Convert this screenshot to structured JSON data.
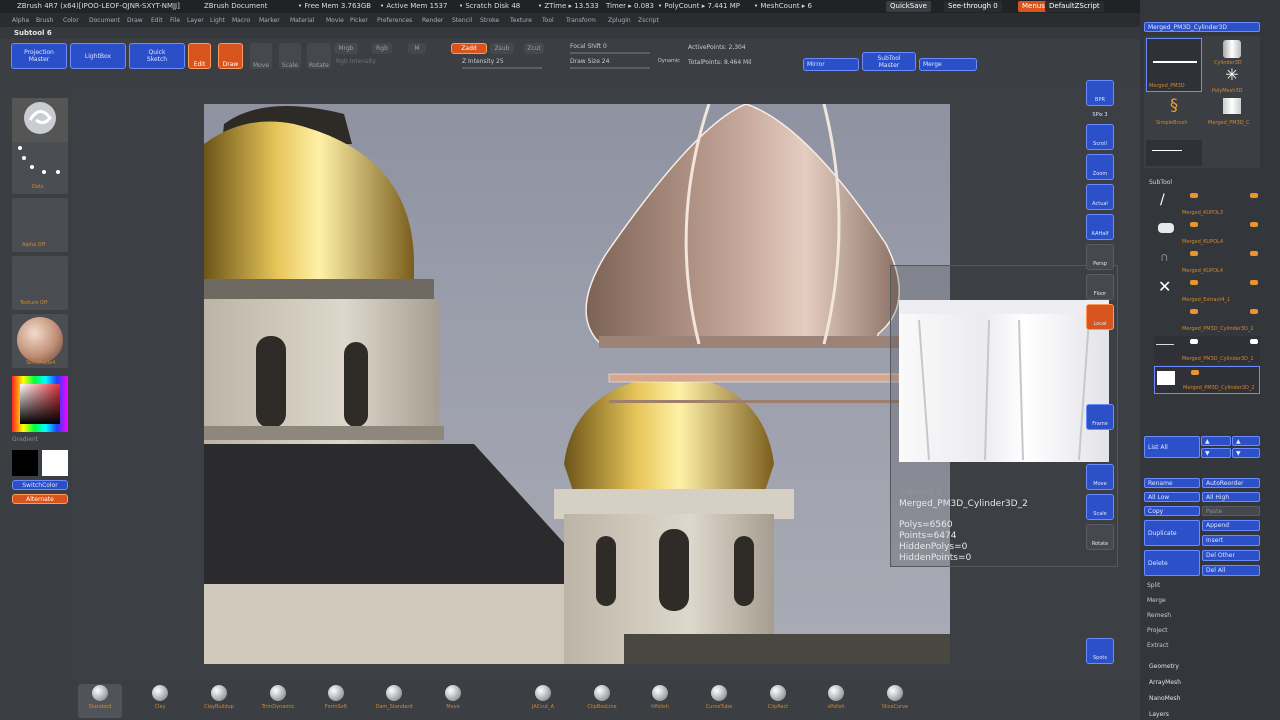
{
  "titlebar": {
    "app": "ZBrush 4R7 (x64)[IPOO-LEOF-QJNR-SXYT-NMJJ]",
    "doc": "ZBrush Document",
    "free_mem": "• Free Mem 3.763GB",
    "active_mem": "• Active Mem 1537",
    "scratch": "• Scratch Disk 48",
    "ztime": "• ZTime ▸ 13.533",
    "timer": "Timer ▸ 0.083",
    "polycount": "• PolyCount ▸ 7.441 MP",
    "meshcount": "• MeshCount ▸ 6",
    "quicksave": "QuickSave",
    "seethrough": "See-through  0",
    "menus": "Menus",
    "script": "DefaultZScript"
  },
  "menus": [
    "Alpha",
    "Brush",
    "Color",
    "Document",
    "Draw",
    "Edit",
    "File",
    "Layer",
    "Light",
    "Macro",
    "Marker",
    "Material",
    "Movie",
    "Picker",
    "Preferences",
    "Render",
    "Stencil",
    "Stroke",
    "Texture",
    "Tool",
    "Transform",
    "Zplugin",
    "Zscript"
  ],
  "subtool_label": "Subtool 6",
  "shelf": {
    "projection": "Projection\nMaster",
    "lightbox": "LightBox",
    "quicksketch": "Quick\nSketch",
    "edit": "Edit",
    "draw": "Draw",
    "move": "Move",
    "scale": "Scale",
    "rotate": "Rotate",
    "mrgb": "Mrgb",
    "rgb": "Rgb",
    "m": "M",
    "rgb_intensity": "Rgb Intensity",
    "zadd": "Zadd",
    "zsub": "Zsub",
    "zcut": "Zcut",
    "z_intensity": "Z Intensity 25",
    "focal_shift": "Focal Shift 0",
    "draw_size": "Draw Size 24",
    "dynamic": "Dynamic",
    "active_points": "ActivePoints: 2,304",
    "total_points": "TotalPoints: 8.464 Mil",
    "mirror": "Mirror",
    "subtool_master": "SubTool\nMaster",
    "merge": "Merge"
  },
  "left": {
    "dots_label": "Dots",
    "alpha_label": "Alpha Off",
    "texture_label": "Texture Off",
    "material_label": "SkinShade4",
    "gradient": "Gradient",
    "switchcolor": "SwitchColor",
    "alternate": "Alternate"
  },
  "rightbtns": [
    "BPR",
    "SPix 3",
    "Scroll",
    "Zoom",
    "Actual",
    "AAHalf",
    "Persp",
    "Floor",
    "Local",
    "Frame",
    "Move",
    "Scale",
    "Rotate",
    "Spots"
  ],
  "tool": {
    "title": "Merged_PM3D_Cylinder3D",
    "thumb1": "Merged_PM3D",
    "thumb2": "Cylinder3D",
    "thumb3": "PolyMesh3D",
    "thumb4": "SimpleBrush",
    "thumb5": "Merged_PM3D_C"
  },
  "subtool": {
    "header": "SubTool",
    "rows": [
      "Merged_KUPOL3",
      "Merged_KUPOL4",
      "Merged_KUPOL4",
      "Merged_Extract4_1",
      "Merged_PM3D_Cylinder3D_2",
      "Merged_PM3D_Cylinder3D_1",
      "Merged_PM3D_Cylinder3D_2"
    ],
    "list_all": "List All",
    "rename": "Rename",
    "autoreorder": "AutoReorder",
    "all_low": "All Low",
    "all_high": "All High",
    "copy": "Copy",
    "paste": "Paste",
    "duplicate": "Duplicate",
    "append": "Append",
    "insert": "Insert",
    "delete": "Delete",
    "del_other": "Del Other",
    "del_all": "Del All",
    "split": "Split",
    "merge": "Merge",
    "remesh": "Remesh",
    "project": "Project",
    "extract": "Extract"
  },
  "sections": [
    "Geometry",
    "ArrayMesh",
    "NanoMesh",
    "Layers"
  ],
  "info": {
    "subtool": "Subtool 6",
    "name": "Merged_PM3D_Cylinder3D_2",
    "polys": "Polys=6560",
    "points": "Points=6474",
    "hidden_polys": "HiddenPolys=0",
    "hidden_points": "HiddenPoints=0"
  },
  "brushes": [
    "Standard",
    "Clay",
    "ClayBuildup",
    "TrimDynamic",
    "FormSoft",
    "Dam_Standard",
    "Move",
    "JACcut_A",
    "ClipBoxLine",
    "hPolish",
    "CurveTube",
    "ClipRect",
    "sPolish",
    "SliceCurve"
  ],
  "colors": {
    "accent_blue": "#2c50c8",
    "accent_orange": "#d8541d",
    "bg": "#3c3f44"
  }
}
